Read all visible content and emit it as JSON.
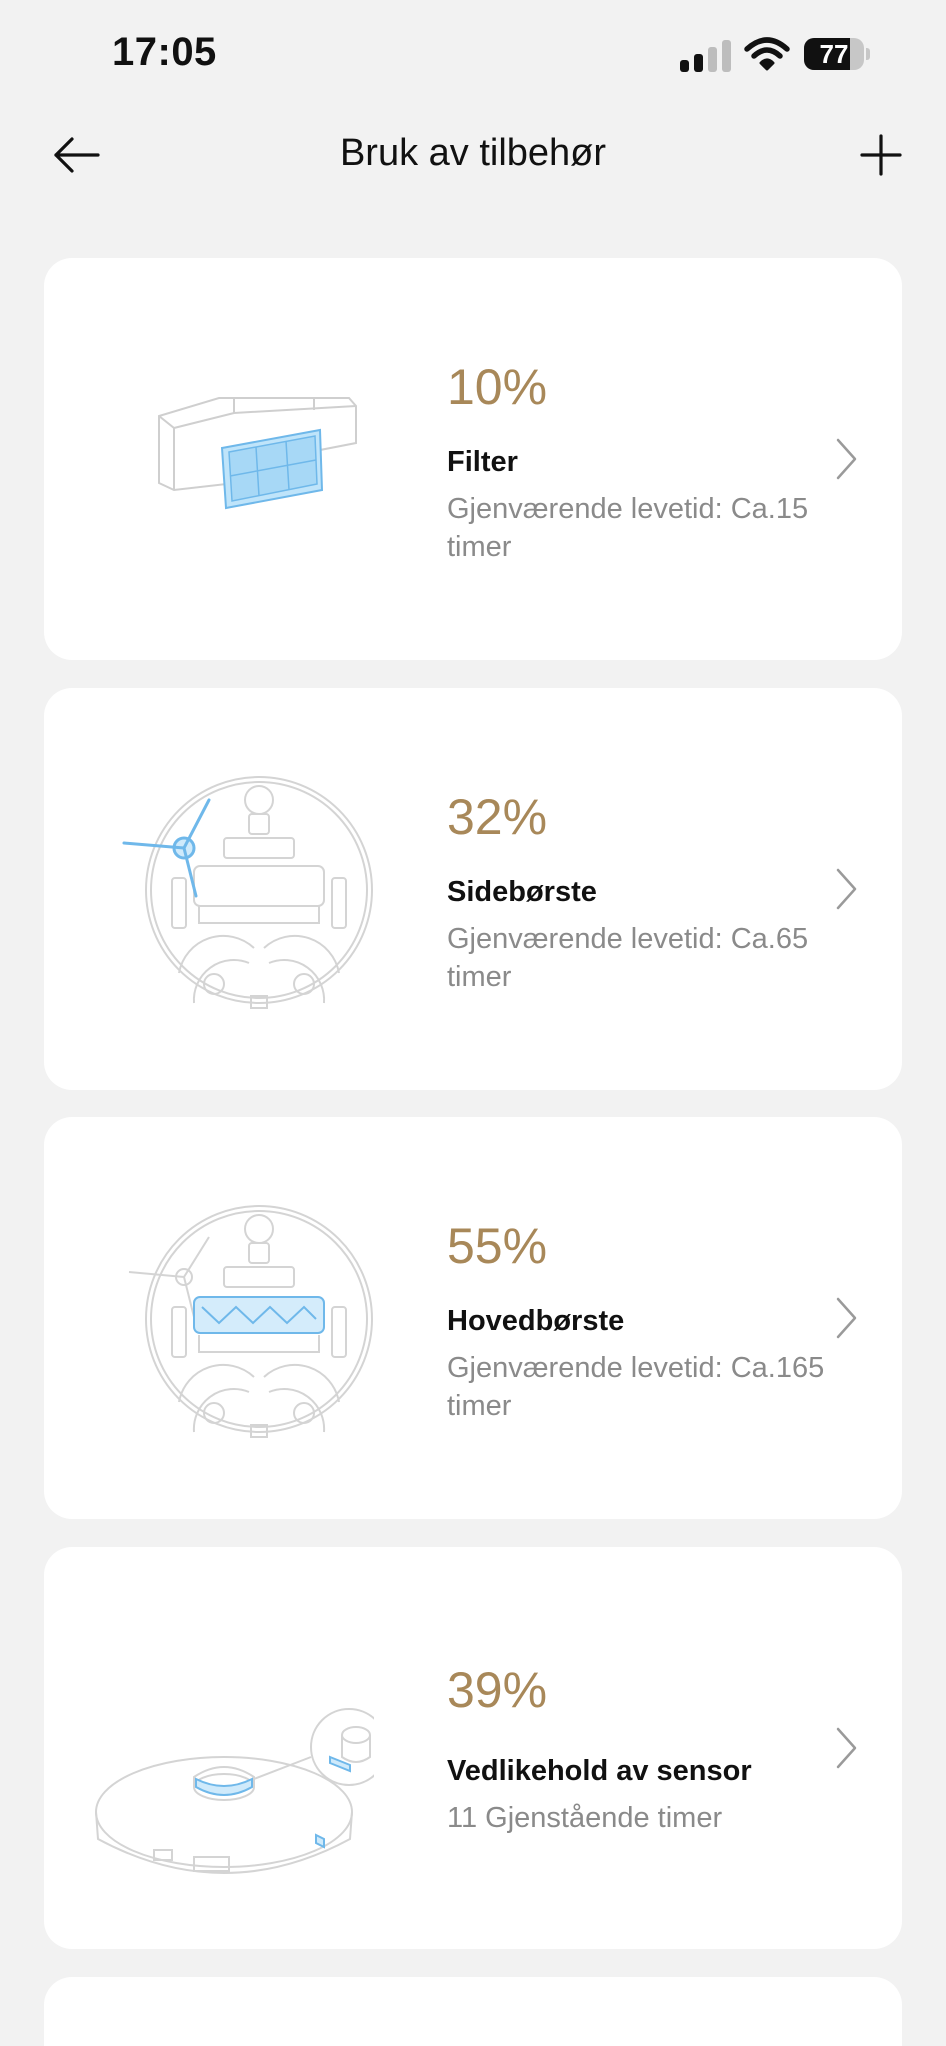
{
  "status_bar": {
    "time": "17:05",
    "battery": "77",
    "battery_level": 0.77
  },
  "header": {
    "title": "Bruk av tilbehør",
    "back_icon": "arrow-left-icon",
    "add_icon": "plus-icon"
  },
  "accessories": [
    {
      "percent": "10%",
      "name": "Filter",
      "remaining": "Gjenværende levetid: Ca.15 timer",
      "illustration": "filter-illustration"
    },
    {
      "percent": "32%",
      "name": "Sidebørste",
      "remaining": "Gjenværende levetid: Ca.65 timer",
      "illustration": "side-brush-illustration"
    },
    {
      "percent": "55%",
      "name": "Hovedbørste",
      "remaining": "Gjenværende levetid: Ca.165 timer",
      "illustration": "main-brush-illustration"
    },
    {
      "percent": "39%",
      "name": "Vedlikehold av sensor",
      "remaining": "11 Gjenstående timer",
      "illustration": "sensor-illustration"
    }
  ],
  "colors": {
    "accent": "#a88859",
    "background": "#f2f2f2",
    "card": "#ffffff",
    "secondary_text": "#8a8a8a",
    "highlight_blue": "#7fc4ef"
  }
}
